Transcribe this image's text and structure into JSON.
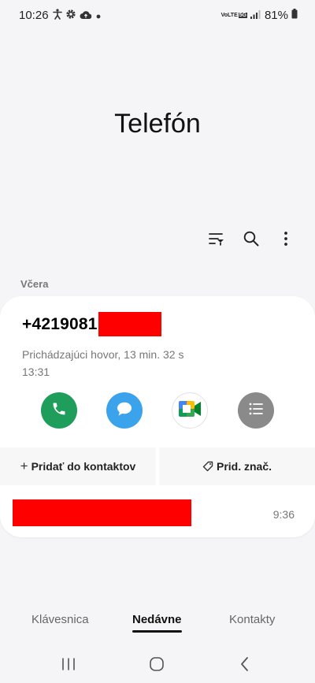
{
  "status_bar": {
    "time": "10:26",
    "network_top": "VoLTE",
    "network_badge": "5G",
    "battery": "81%"
  },
  "app": {
    "title": "Telefón"
  },
  "toolbar": {
    "icons": [
      "filter-icon",
      "search-icon",
      "more-vertical-icon"
    ]
  },
  "recents": {
    "section_label": "Včera",
    "expanded_entry": {
      "number_prefix": "+4219081",
      "call_type": "Prichádzajúci hovor, 13 min. 32 s",
      "time": "13:31",
      "actions": [
        "phone-icon",
        "message-icon",
        "video-call-icon",
        "details-icon"
      ],
      "add_contact_label": "Pridať do kontaktov",
      "add_tag_label": "Prid. znač."
    },
    "second_entry": {
      "time": "9:36"
    }
  },
  "tabs": {
    "keypad": "Klávesnica",
    "recents": "Nedávne",
    "contacts": "Kontakty",
    "active": "recents"
  },
  "colors": {
    "call": "#1e9e5a",
    "message": "#3aa3ec",
    "details": "#8a8a8a",
    "redaction": "#ff0000"
  }
}
